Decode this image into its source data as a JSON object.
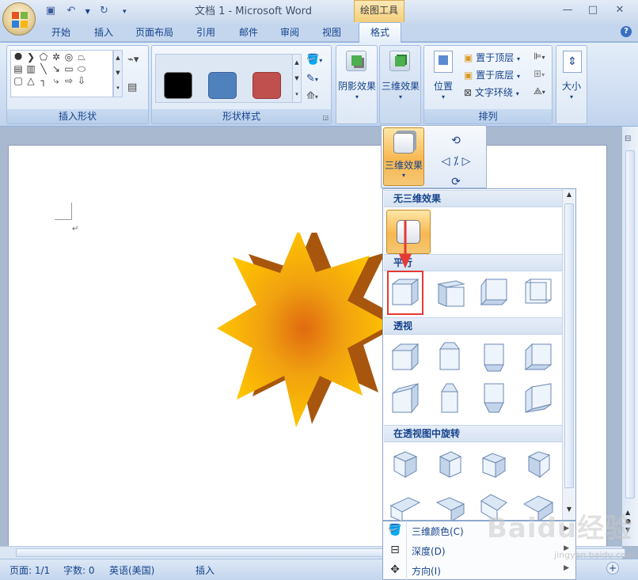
{
  "window": {
    "title": "文档 1 - Microsoft Word",
    "context_tab_group": "绘图工具",
    "help_icon": "?"
  },
  "quick_access": {
    "icons": [
      "save-icon",
      "undo-icon",
      "redo-icon",
      "customize-icon"
    ]
  },
  "tabs": [
    "开始",
    "插入",
    "页面布局",
    "引用",
    "邮件",
    "审阅",
    "视图",
    "格式"
  ],
  "active_tab": "格式",
  "ribbon": {
    "insert_shapes": {
      "label": "插入形状"
    },
    "shape_styles": {
      "label": "形状样式",
      "swatches": [
        "#000000",
        "#4f81bd",
        "#c0504d"
      ]
    },
    "shadow": {
      "label": "阴影效果"
    },
    "threed": {
      "label": "三维效果"
    },
    "arrange": {
      "label": "排列",
      "position": "位置",
      "bring_front": "置于顶层",
      "send_back": "置于底层",
      "text_wrap": "文字环绕"
    },
    "size": {
      "label": "大小"
    }
  },
  "threed_button": {
    "label": "三维效果"
  },
  "gallery": {
    "no_3d": "无三维效果",
    "parallel": "平行",
    "perspective": "透视",
    "rotate_in_perspective": "在透视图中旋转"
  },
  "menu": {
    "color": "三维颜色(C)",
    "depth": "深度(D)",
    "direction": "方向(I)"
  },
  "status": {
    "page": "页面: 1/1",
    "words": "字数: 0",
    "language": "英语(美国)",
    "mode": "插入"
  },
  "watermark": {
    "text": "Baidu经验",
    "sub": "jingyan.baidu.com"
  },
  "colors": {
    "star_gold": "#f5b400",
    "star_center": "#e07a10",
    "star_side": "#a8560d",
    "highlight": "#e53935"
  }
}
